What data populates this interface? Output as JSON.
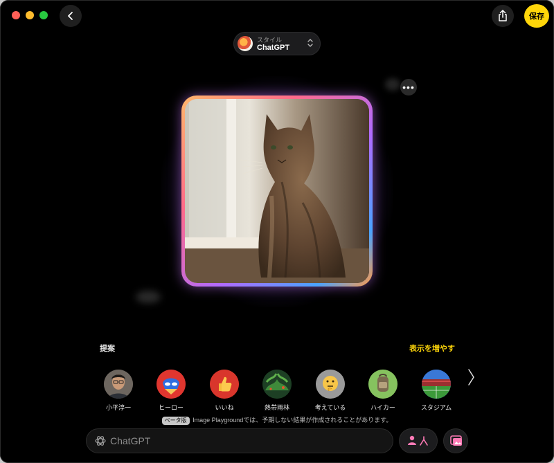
{
  "toolbar": {
    "save_label": "保存"
  },
  "style_picker": {
    "label_small": "スタイル",
    "value": "ChatGPT"
  },
  "suggestions": {
    "heading": "提案",
    "show_more": "表示を増やす",
    "items": [
      {
        "label": "小平淳一",
        "icon": "person-avatar-icon"
      },
      {
        "label": "ヒーロー",
        "icon": "hero-mask-icon"
      },
      {
        "label": "いいね",
        "icon": "thumbs-up-icon"
      },
      {
        "label": "熱帯雨林",
        "icon": "rainforest-icon"
      },
      {
        "label": "考えている",
        "icon": "thinking-face-icon"
      },
      {
        "label": "ハイカー",
        "icon": "backpack-icon"
      },
      {
        "label": "スタジアム",
        "icon": "stadium-icon"
      }
    ]
  },
  "disclaimer": {
    "badge": "ベータ版",
    "text": "Image Playgroundでは、予期しない結果が作成されることがあります。"
  },
  "prompt": {
    "placeholder": "ChatGPT"
  },
  "colors": {
    "accent": "#ffd60a",
    "background": "#000000"
  }
}
